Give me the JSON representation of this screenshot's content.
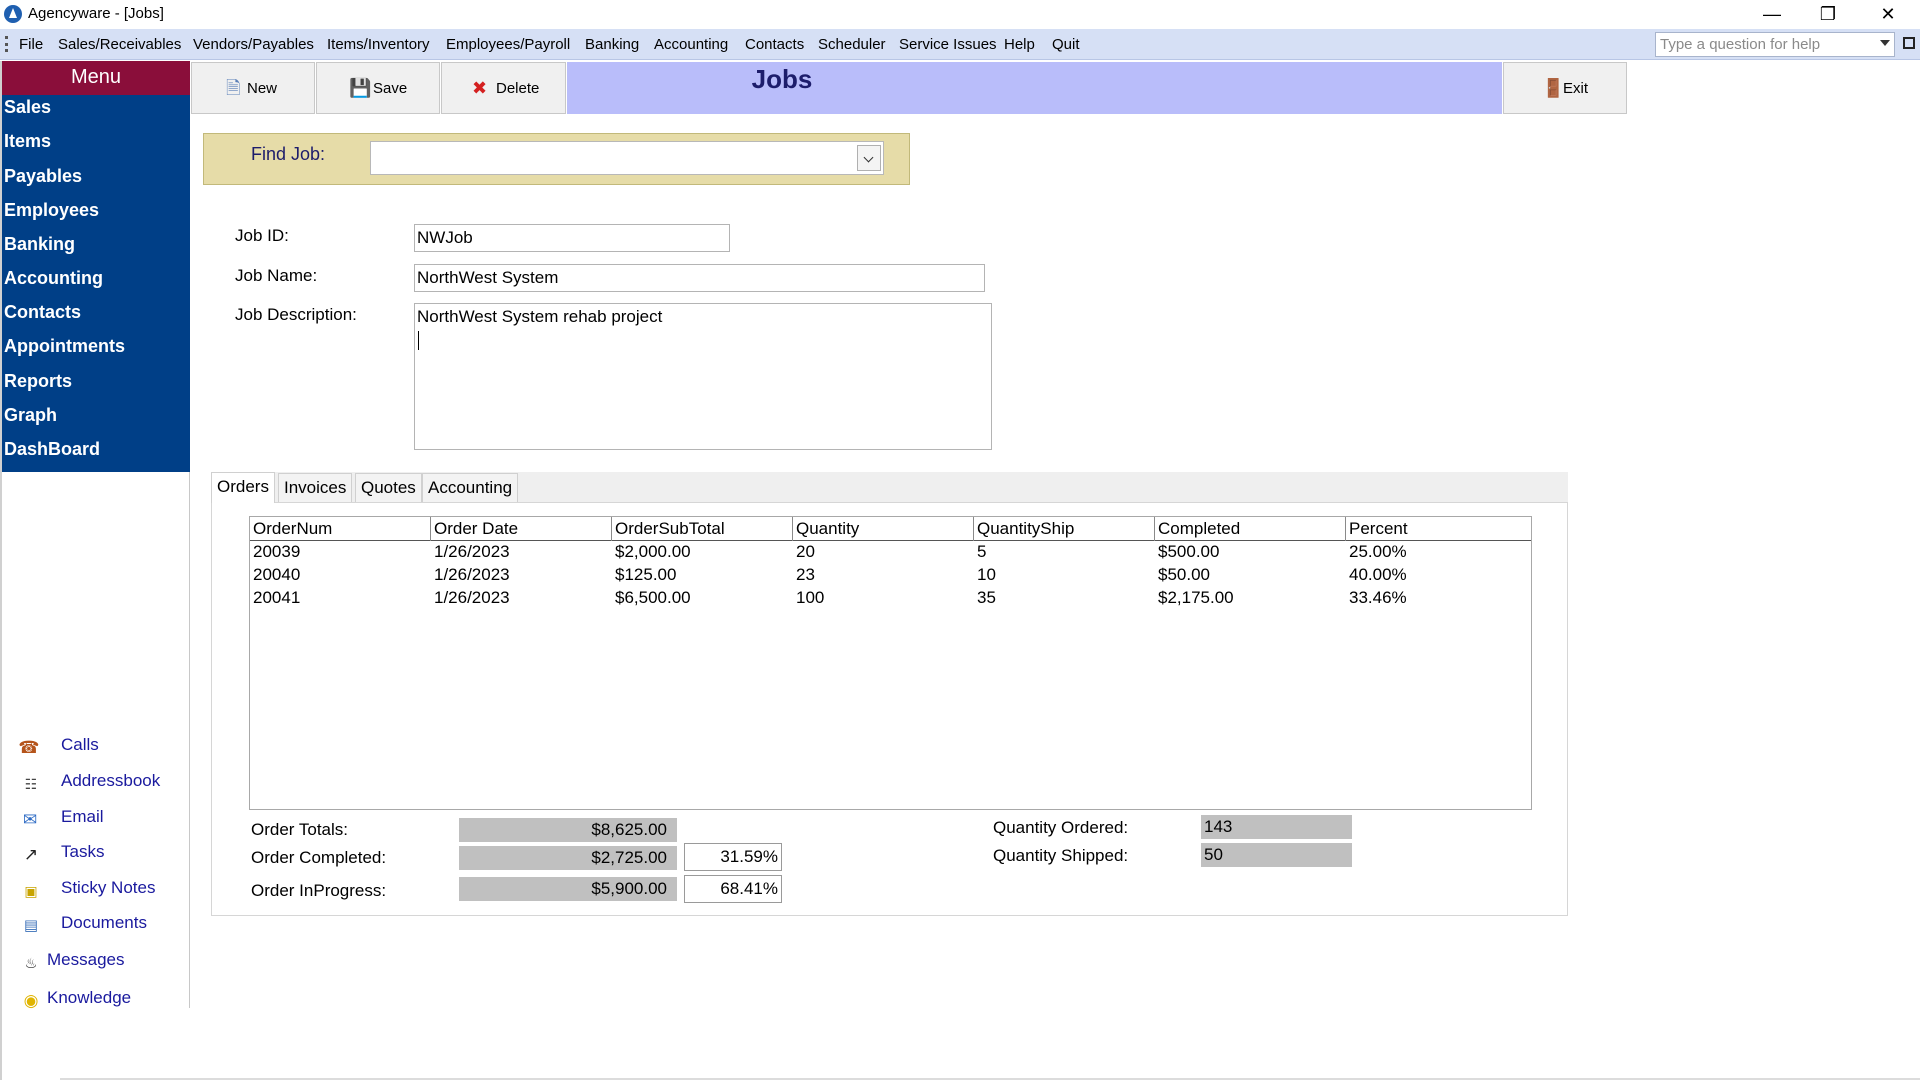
{
  "window": {
    "title": "Agencyware - [Jobs]"
  },
  "menubar": {
    "items": [
      "File",
      "Sales/Receivables",
      "Vendors/Payables",
      "Items/Inventory",
      "Employees/Payroll",
      "Banking",
      "Accounting",
      "Contacts",
      "Scheduler",
      "Service Issues",
      "Help",
      "Quit"
    ],
    "help_placeholder": "Type a question for help"
  },
  "sidebar": {
    "header": "Menu",
    "items": [
      "Sales",
      "Items",
      "Payables",
      "Employees",
      "Banking",
      "Accounting",
      "Contacts",
      "Appointments",
      "Reports",
      "Graph",
      "DashBoard"
    ],
    "quick_links": [
      {
        "label": "Calls",
        "icon": "phone-icon"
      },
      {
        "label": "Addressbook",
        "icon": "addressbook-icon"
      },
      {
        "label": "Email",
        "icon": "email-icon"
      },
      {
        "label": "Tasks",
        "icon": "tasks-icon"
      },
      {
        "label": "Sticky Notes",
        "icon": "sticky-notes-icon"
      },
      {
        "label": "Documents",
        "icon": "documents-icon"
      },
      {
        "label": "Messages",
        "icon": "messages-icon"
      },
      {
        "label": "Knowledge",
        "icon": "lightbulb-icon"
      }
    ]
  },
  "toolbar": {
    "new_label": "New",
    "save_label": "Save",
    "delete_label": "Delete",
    "exit_label": "Exit",
    "page_title": "Jobs"
  },
  "find": {
    "label": "Find Job:",
    "value": ""
  },
  "form": {
    "job_id_label": "Job ID:",
    "job_id": "NWJob",
    "job_name_label": "Job Name:",
    "job_name": "NorthWest System",
    "job_desc_label": "Job Description:",
    "job_desc": "NorthWest System rehab project"
  },
  "tabs": [
    "Orders",
    "Invoices",
    "Quotes",
    "Accounting"
  ],
  "orders": {
    "columns": [
      "OrderNum",
      "Order Date",
      "OrderSubTotal",
      "Quantity",
      "QuantityShip",
      "Completed",
      "Percent"
    ],
    "rows": [
      [
        "20039",
        "1/26/2023",
        "$2,000.00",
        "20",
        "5",
        "$500.00",
        "25.00%"
      ],
      [
        "20040",
        "1/26/2023",
        "$125.00",
        "23",
        "10",
        "$50.00",
        "40.00%"
      ],
      [
        "20041",
        "1/26/2023",
        "$6,500.00",
        "100",
        "35",
        "$2,175.00",
        "33.46%"
      ]
    ]
  },
  "totals": {
    "order_totals_label": "Order Totals:",
    "order_totals": "$8,625.00",
    "order_completed_label": "Order Completed:",
    "order_completed": "$2,725.00",
    "order_completed_pct": "31.59%",
    "order_inprogress_label": "Order InProgress:",
    "order_inprogress": "$5,900.00",
    "order_inprogress_pct": "68.41%",
    "qty_ordered_label": "Quantity Ordered:",
    "qty_ordered": "143",
    "qty_shipped_label": "Quantity Shipped:",
    "qty_shipped": "50"
  }
}
